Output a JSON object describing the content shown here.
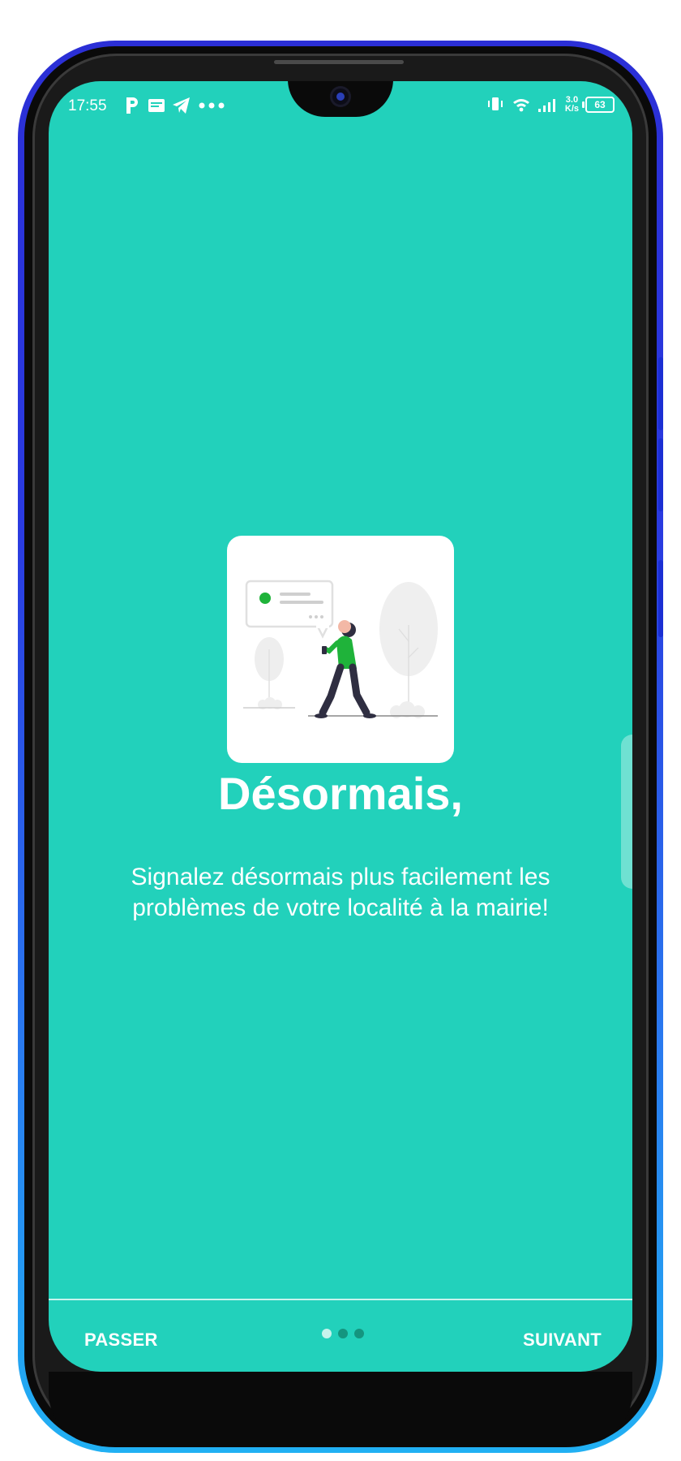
{
  "status_bar": {
    "time": "17:55",
    "speed_value": "3.0",
    "speed_unit": "K/s",
    "battery": "63",
    "left_icons": [
      "parking-icon",
      "notes-icon",
      "telegram-icon",
      "more-dots-icon"
    ],
    "right_icons": [
      "vibrate-icon",
      "wifi-icon",
      "signal-icon"
    ]
  },
  "onboarding": {
    "headline": "Désormais,",
    "description": "Signalez désormais plus facilement les problèmes de votre localité à la mairie!",
    "illustration": "person-walking-with-phone-illustration",
    "pages": 3,
    "current_page": 1
  },
  "navigation": {
    "skip_label": "PASSER",
    "next_label": "SUIVANT"
  },
  "colors": {
    "background": "#22d1bb",
    "accent_green": "#1fb33a",
    "dot_active": "#c6f3ec",
    "dot_inactive": "#14957f",
    "frame_top": "#2b2fd6",
    "frame_bottom": "#21b0f3"
  }
}
